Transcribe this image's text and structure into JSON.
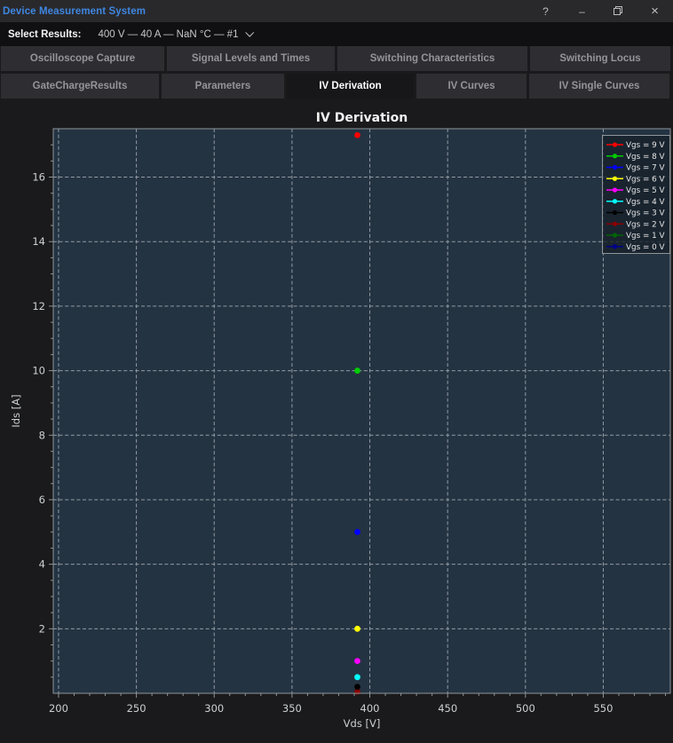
{
  "window": {
    "title": "Device Measurement System",
    "controls": {
      "help": "?",
      "minimize": "–",
      "close": "×"
    }
  },
  "results_bar": {
    "label": "Select Results:",
    "selected": "400 V — 40 A — NaN °C — #1"
  },
  "tabs": {
    "row1": [
      {
        "label": "Oscilloscope Capture",
        "active": false
      },
      {
        "label": "Signal Levels and Times",
        "active": false
      },
      {
        "label": "Switching Characteristics",
        "active": false
      },
      {
        "label": "Switching Locus",
        "active": false
      }
    ],
    "row2": [
      {
        "label": "GateChargeResults",
        "active": false
      },
      {
        "label": "Parameters",
        "active": false
      },
      {
        "label": "IV Derivation",
        "active": true
      },
      {
        "label": "IV Curves",
        "active": false
      },
      {
        "label": "IV Single Curves",
        "active": false
      }
    ]
  },
  "colors": {
    "title_accent": "#3f86e0",
    "plot_bg": "#243342",
    "grid": "#b7bec4",
    "spine": "#8e9499",
    "tick_label": "#cdd0d2",
    "chart_title": "#f2f2f2",
    "axis_label": "#cdd0d2",
    "legend_text": "#e6e6e6",
    "legend_bg": "#16212b"
  },
  "chart_data": {
    "type": "scatter",
    "title": "IV Derivation",
    "xlabel": "Vds [V]",
    "ylabel": "Ids [A]",
    "xlim": [
      196.6,
      593.1
    ],
    "ylim": [
      0,
      17.5
    ],
    "xticks": [
      200,
      250,
      300,
      350,
      400,
      450,
      500,
      550
    ],
    "yticks": [
      2,
      4,
      6,
      8,
      10,
      12,
      14,
      16
    ],
    "x_minor_step": 10,
    "y_minor_step": 0.5,
    "grid": "dashed-major",
    "legend_position": "upper right",
    "series": [
      {
        "name": "Vgs = 9 V",
        "color": "#ff0000",
        "points": [
          [
            392,
            17.3
          ]
        ]
      },
      {
        "name": "Vgs = 8 V",
        "color": "#00cc00",
        "points": [
          [
            392,
            10.0
          ]
        ]
      },
      {
        "name": "Vgs = 7 V",
        "color": "#0000ff",
        "points": [
          [
            392,
            5.0
          ]
        ]
      },
      {
        "name": "Vgs = 6 V",
        "color": "#ffff00",
        "points": [
          [
            392,
            2.0
          ]
        ]
      },
      {
        "name": "Vgs = 5 V",
        "color": "#ff00ff",
        "points": [
          [
            392,
            1.0
          ]
        ]
      },
      {
        "name": "Vgs = 4 V",
        "color": "#00ffff",
        "points": [
          [
            392,
            0.5
          ]
        ]
      },
      {
        "name": "Vgs = 3 V",
        "color": "#000000",
        "points": [
          [
            392,
            0.2
          ]
        ]
      },
      {
        "name": "Vgs = 2 V",
        "color": "#8b0000",
        "points": [
          [
            392,
            0.05
          ]
        ]
      },
      {
        "name": "Vgs = 1 V",
        "color": "#006400",
        "points": [
          [
            392,
            0.05
          ]
        ]
      },
      {
        "name": "Vgs = 0 V",
        "color": "#00008b",
        "points": [
          [
            392,
            0.05
          ]
        ]
      }
    ]
  }
}
